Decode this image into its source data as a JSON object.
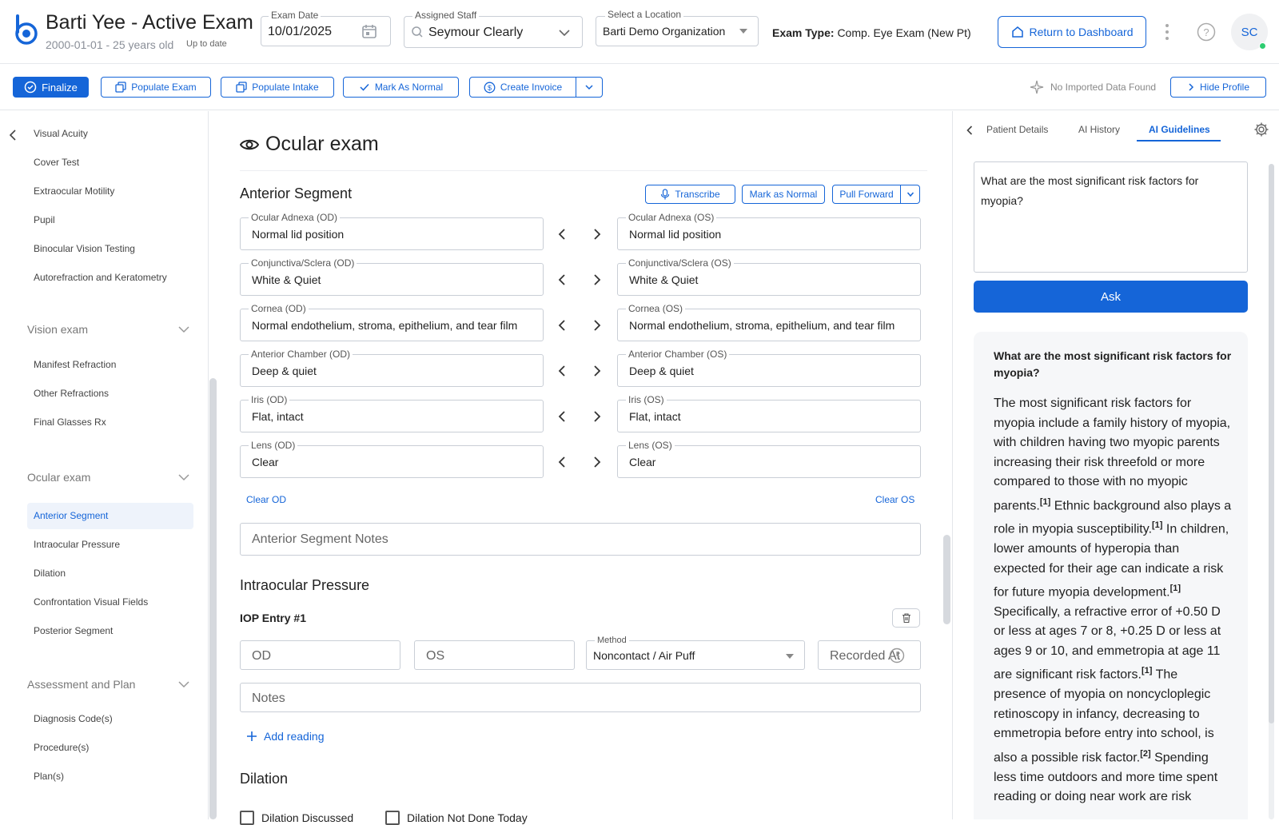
{
  "header": {
    "patient_name": "Barti Yee - Active Exam",
    "patient_dob": "2000-01-01 - 25 years old",
    "status": "Up to date",
    "exam_date_label": "Exam Date",
    "exam_date_value": "10/01/2025",
    "staff_label": "Assigned Staff",
    "staff_value": "Seymour Clearly",
    "location_label": "Select a Location",
    "location_value": "Barti Demo Organization",
    "exam_type_label": "Exam Type:",
    "exam_type_value": "Comp. Eye Exam (New Pt)",
    "dashboard_button": "Return to Dashboard",
    "avatar_initials": "SC"
  },
  "toolbar": {
    "finalize": "Finalize",
    "populate_exam": "Populate Exam",
    "populate_intake": "Populate Intake",
    "mark_normal": "Mark As Normal",
    "create_invoice": "Create Invoice",
    "no_data": "No Imported Data Found",
    "hide_profile": "Hide Profile"
  },
  "sidebar": {
    "top_items": [
      "Visual Acuity",
      "Cover Test",
      "Extraocular Motility",
      "Pupil",
      "Binocular Vision Testing",
      "Autorefraction and Keratometry"
    ],
    "vision_group": "Vision exam",
    "vision_items": [
      "Manifest Refraction",
      "Other Refractions",
      "Final Glasses Rx"
    ],
    "ocular_group": "Ocular exam",
    "ocular_items": [
      "Anterior Segment",
      "Intraocular Pressure",
      "Dilation",
      "Confrontation Visual Fields",
      "Posterior Segment"
    ],
    "assessment_group": "Assessment and Plan",
    "assessment_items": [
      "Diagnosis Code(s)",
      "Procedure(s)",
      "Plan(s)"
    ]
  },
  "main": {
    "title": "Ocular exam",
    "anterior": {
      "heading": "Anterior Segment",
      "transcribe": "Transcribe",
      "mark_normal": "Mark as Normal",
      "pull_forward": "Pull Forward",
      "rows": [
        {
          "od_label": "Ocular Adnexa (OD)",
          "od_value": "Normal lid position",
          "os_label": "Ocular Adnexa (OS)",
          "os_value": "Normal lid position"
        },
        {
          "od_label": "Conjunctiva/Sclera (OD)",
          "od_value": "White & Quiet",
          "os_label": "Conjunctiva/Sclera (OS)",
          "os_value": "White & Quiet"
        },
        {
          "od_label": "Cornea (OD)",
          "od_value": "Normal endothelium, stroma, epithelium, and tear film",
          "os_label": "Cornea (OS)",
          "os_value": "Normal endothelium, stroma, epithelium, and tear film"
        },
        {
          "od_label": "Anterior Chamber (OD)",
          "od_value": "Deep & quiet",
          "os_label": "Anterior Chamber (OS)",
          "os_value": "Deep & quiet"
        },
        {
          "od_label": "Iris (OD)",
          "od_value": "Flat, intact",
          "os_label": "Iris (OS)",
          "os_value": "Flat, intact"
        },
        {
          "od_label": "Lens (OD)",
          "od_value": "Clear",
          "os_label": "Lens (OS)",
          "os_value": "Clear"
        }
      ],
      "clear_od": "Clear OD",
      "clear_os": "Clear OS",
      "notes_placeholder": "Anterior Segment Notes"
    },
    "iop": {
      "heading": "Intraocular Pressure",
      "entry": "IOP Entry #1",
      "od_placeholder": "OD",
      "os_placeholder": "OS",
      "method_label": "Method",
      "method_value": "Noncontact / Air Puff",
      "recorded_placeholder": "Recorded At",
      "notes_placeholder": "Notes",
      "add_reading": "Add reading"
    },
    "dilation": {
      "heading": "Dilation",
      "discussed": "Dilation Discussed",
      "not_done": "Dilation Not Done Today"
    }
  },
  "right_panel": {
    "tabs": [
      "Patient Details",
      "AI History",
      "AI Guidelines"
    ],
    "question": "What are the most significant risk factors for myopia?",
    "ask_button": "Ask",
    "answer_question": "What are the most significant risk factors for myopia?",
    "answer_parts": [
      {
        "text": "The most significant risk factors for myopia include a family history of myopia, with children having two myopic parents increasing their risk threefold or more compared to those with no myopic parents.",
        "ref": "[1]"
      },
      {
        "text": " Ethnic background also plays a role in myopia susceptibility.",
        "ref": "[1]"
      },
      {
        "text": " In children, lower amounts of hyperopia than expected for their age can indicate a risk for future myopia development.",
        "ref": "[1]"
      },
      {
        "text": " Specifically, a refractive error of +0.50 D or less at ages 7 or 8, +0.25 D or less at ages 9 or 10, and emmetropia at age 11 are significant risk factors.",
        "ref": "[1]"
      },
      {
        "text": " The presence of myopia on noncycloplegic retinoscopy in infancy, decreasing to emmetropia before entry into school, is also a possible risk factor.",
        "ref": "[2]"
      },
      {
        "text": " Spending less time outdoors and more time spent reading or doing near work are risk",
        "ref": ""
      }
    ]
  },
  "colors": {
    "accent": "#1565d8",
    "active_bg": "#eef3fb",
    "online": "#2ecc71"
  }
}
